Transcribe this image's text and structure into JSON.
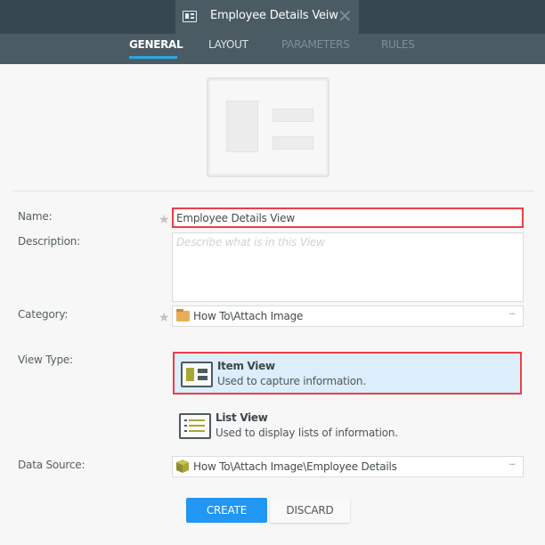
{
  "window": {
    "tab_title": "Employee Details Veiw",
    "tab_icon": "view-icon",
    "close_icon": "close-icon"
  },
  "nav": {
    "tabs": [
      {
        "label": "GENERAL",
        "state": "active"
      },
      {
        "label": "LAYOUT",
        "state": "normal"
      },
      {
        "label": "PARAMETERS",
        "state": "disabled"
      },
      {
        "label": "RULES",
        "state": "disabled"
      }
    ]
  },
  "form": {
    "name": {
      "label": "Name:",
      "value": "Employee Details View",
      "required": true
    },
    "description": {
      "label": "Description:",
      "placeholder": "Describe what is in this View",
      "value": ""
    },
    "category": {
      "label": "Category:",
      "value": "How To\\Attach Image",
      "required": true,
      "icon": "folder-icon",
      "browse": "···"
    },
    "view_type": {
      "label": "View Type:",
      "options": [
        {
          "title": "Item View",
          "description": "Used to capture information.",
          "selected": true,
          "icon": "item-view-icon"
        },
        {
          "title": "List View",
          "description": "Used to display lists of information.",
          "selected": false,
          "icon": "list-view-icon"
        }
      ]
    },
    "data_source": {
      "label": "Data Source:",
      "value": "How To\\Attach Image\\Employee Details",
      "icon": "smartobject-cube-icon",
      "browse": "···"
    }
  },
  "actions": {
    "create": "CREATE",
    "discard": "DISCARD"
  },
  "colors": {
    "accent": "#2196f3",
    "highlight": "#ec3f46",
    "selected_bg": "#dcedfb",
    "header_bg": "#37474f",
    "tab_underline": "#29a8e0"
  }
}
